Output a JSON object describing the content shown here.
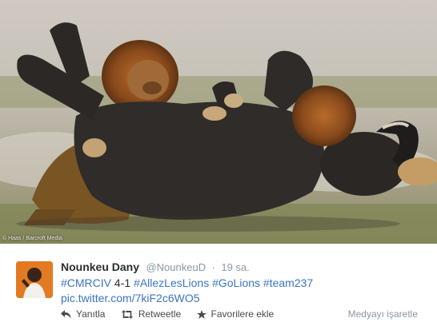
{
  "photo": {
    "description_icon": "photo-media",
    "credit": "© Haas / Barcroft Media"
  },
  "tweet": {
    "fullname": "Nounkeu Dany",
    "username": "@NounkeuD",
    "separator": "·",
    "time": "19 sa.",
    "text_parts": {
      "tag1": "#CMRCIV",
      "score": " 4-1 ",
      "tag2": "#AllezLesLions",
      "space1": " ",
      "tag3": "#GoLions",
      "space2": " ",
      "tag4": "#team237",
      "link": "pic.twitter.com/7kiF2c6WO5"
    },
    "actions": {
      "reply": "Yanıtla",
      "retweet": "Retweetle",
      "favorite": "Favorilere ekle"
    },
    "report_media": "Medyayı işaretle"
  },
  "icons": {
    "reply": "reply-icon",
    "retweet": "retweet-icon",
    "favorite": "star-icon"
  },
  "colors": {
    "link": "#3b74c5",
    "muted": "#8899a6",
    "text": "#292f33"
  }
}
